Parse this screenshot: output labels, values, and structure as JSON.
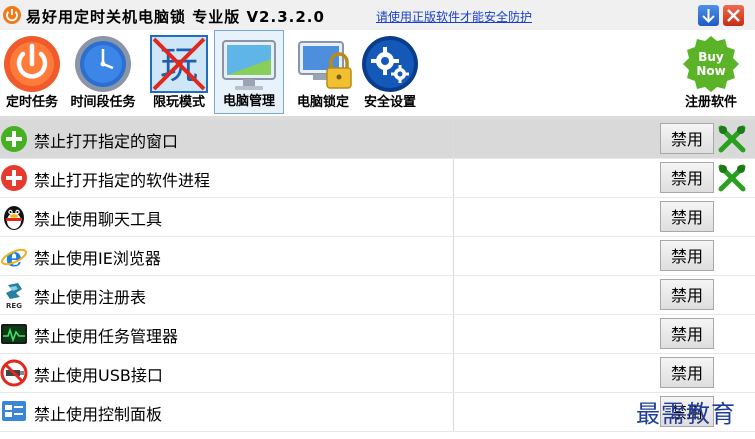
{
  "window": {
    "title": "易好用定时关机电脑锁 专业版 V2.3.2.0",
    "notice_link": "请使用正版软件才能安全防护"
  },
  "toolbar": {
    "items": [
      {
        "label": "定时任务",
        "icon": "power-icon"
      },
      {
        "label": "时间段任务",
        "icon": "clock-icon"
      },
      {
        "label": "限玩模式",
        "icon": "no-play-icon"
      },
      {
        "label": "电脑管理",
        "icon": "monitor-icon",
        "selected": true
      },
      {
        "label": "电脑锁定",
        "icon": "lock-computer-icon"
      },
      {
        "label": "安全设置",
        "icon": "gear-icon"
      },
      {
        "label": "注册软件",
        "icon": "buy-now-icon",
        "badge": "Buy Now"
      }
    ]
  },
  "list": {
    "button_label": "禁用",
    "rows": [
      {
        "text": "禁止打开指定的窗口",
        "icon": "add-icon",
        "selected": true,
        "has_delete": true
      },
      {
        "text": "禁止打开指定的软件进程",
        "icon": "add-icon",
        "has_delete": true
      },
      {
        "text": "禁止使用聊天工具",
        "icon": "qq-penguin-icon"
      },
      {
        "text": "禁止使用IE浏览器",
        "icon": "ie-icon"
      },
      {
        "text": "禁止使用注册表",
        "icon": "registry-icon"
      },
      {
        "text": "禁止使用任务管理器",
        "icon": "task-manager-icon"
      },
      {
        "text": "禁止使用USB接口",
        "icon": "usb-ban-icon"
      },
      {
        "text": "禁止使用控制面板",
        "icon": "control-panel-icon"
      }
    ]
  },
  "watermark": "最需教育"
}
